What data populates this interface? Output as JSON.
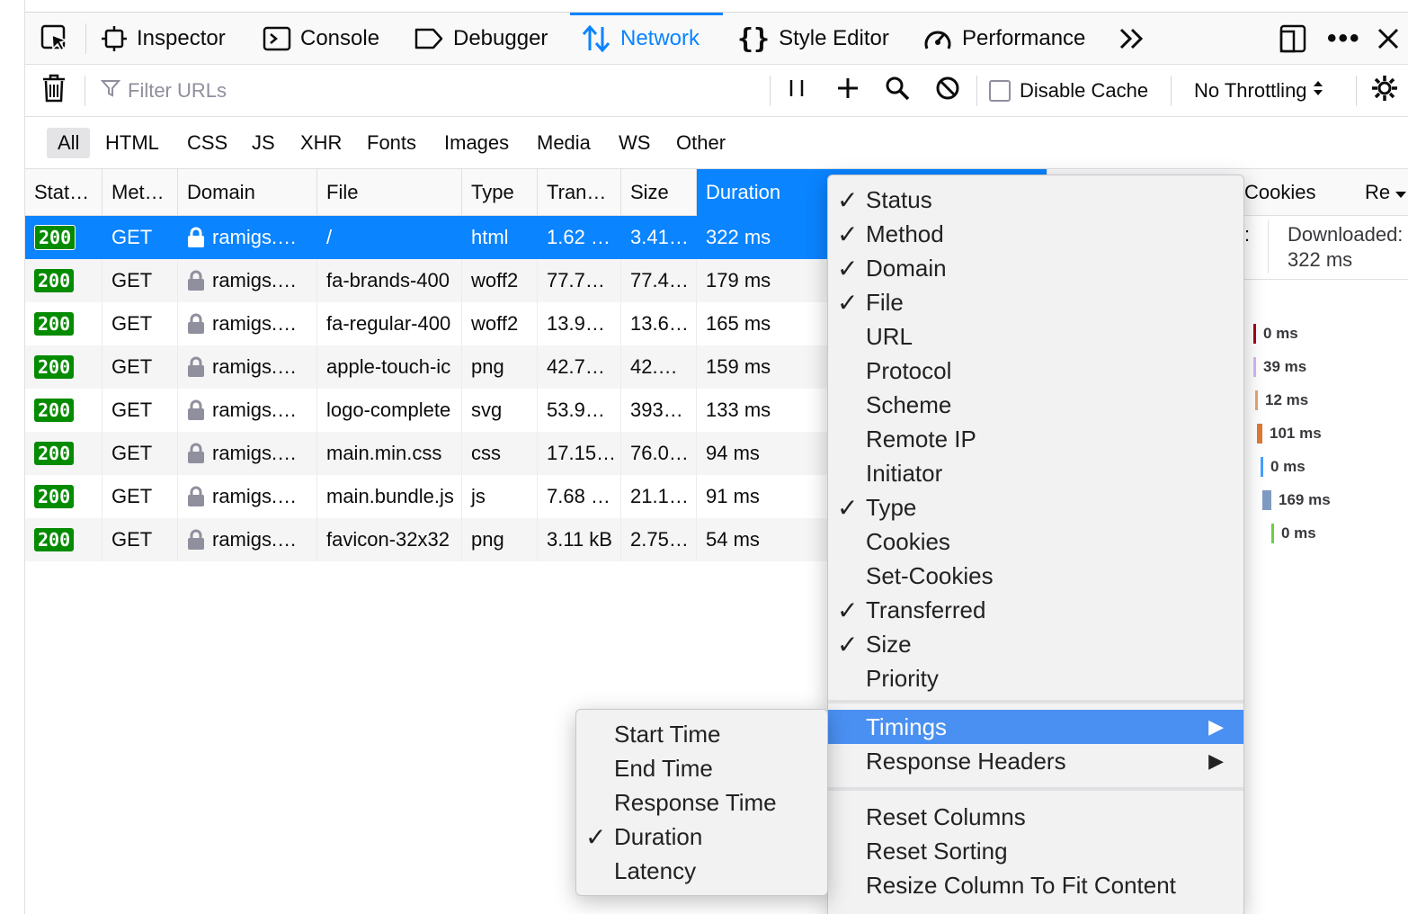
{
  "toolbar": {
    "tabs": [
      {
        "label": "Inspector",
        "icon": "inspector-icon"
      },
      {
        "label": "Console",
        "icon": "console-icon"
      },
      {
        "label": "Debugger",
        "icon": "debugger-icon"
      },
      {
        "label": "Network",
        "icon": "network-icon",
        "active": true
      },
      {
        "label": "Style Editor",
        "icon": "braces-icon"
      },
      {
        "label": "Performance",
        "icon": "gauge-icon"
      }
    ],
    "accent": "#0a84ff"
  },
  "filterbar": {
    "filter_placeholder": "Filter URLs",
    "disable_cache_label": "Disable Cache",
    "throttling_label": "No Throttling"
  },
  "type_filters": [
    "All",
    "HTML",
    "CSS",
    "JS",
    "XHR",
    "Fonts",
    "Images",
    "Media",
    "WS",
    "Other"
  ],
  "table": {
    "headers": [
      "Stat…",
      "Met…",
      "Domain",
      "File",
      "Type",
      "Tran…",
      "Size",
      "Duration",
      "Cookies",
      "Re"
    ],
    "rows": [
      {
        "status": "200",
        "method": "GET",
        "domain": "ramigs.…",
        "file": "/",
        "type": "html",
        "transferred": "1.62 …",
        "size": "3.41…",
        "duration": "322 ms"
      },
      {
        "status": "200",
        "method": "GET",
        "domain": "ramigs.…",
        "file": "fa-brands-400",
        "type": "woff2",
        "transferred": "77.7…",
        "size": "77.4…",
        "duration": "179 ms"
      },
      {
        "status": "200",
        "method": "GET",
        "domain": "ramigs.…",
        "file": "fa-regular-400",
        "type": "woff2",
        "transferred": "13.9…",
        "size": "13.6…",
        "duration": "165 ms"
      },
      {
        "status": "200",
        "method": "GET",
        "domain": "ramigs.…",
        "file": "apple-touch-ic",
        "type": "png",
        "transferred": "42.7…",
        "size": "42.…",
        "duration": "159 ms"
      },
      {
        "status": "200",
        "method": "GET",
        "domain": "ramigs.…",
        "file": "logo-complete",
        "type": "svg",
        "transferred": "53.9…",
        "size": "393…",
        "duration": "133 ms"
      },
      {
        "status": "200",
        "method": "GET",
        "domain": "ramigs.…",
        "file": "main.min.css",
        "type": "css",
        "transferred": "17.15…",
        "size": "76.0…",
        "duration": "94 ms"
      },
      {
        "status": "200",
        "method": "GET",
        "domain": "ramigs.…",
        "file": "main.bundle.js",
        "type": "js",
        "transferred": "7.68 …",
        "size": "21.1…",
        "duration": "91 ms"
      },
      {
        "status": "200",
        "method": "GET",
        "domain": "ramigs.…",
        "file": "favicon-32x32",
        "type": "png",
        "transferred": "3.11 kB",
        "size": "2.75…",
        "duration": "54 ms"
      }
    ]
  },
  "side_panel": {
    "downloaded_label": "Downloaded:",
    "downloaded_value": "322 ms",
    "colon": ":",
    "timings": [
      {
        "value": "0 ms",
        "color": "#a4000f"
      },
      {
        "value": "39 ms",
        "color": "#d7b4f5"
      },
      {
        "value": "12 ms",
        "color": "#e8a36b"
      },
      {
        "value": "101 ms",
        "color": "#e07935"
      },
      {
        "value": "0 ms",
        "color": "#45a1ff"
      },
      {
        "value": "169 ms",
        "color": "#7f9bc2"
      },
      {
        "value": "0 ms",
        "color": "#6ad046"
      }
    ]
  },
  "context_menu": {
    "items": [
      {
        "label": "Status",
        "checked": true
      },
      {
        "label": "Method",
        "checked": true
      },
      {
        "label": "Domain",
        "checked": true
      },
      {
        "label": "File",
        "checked": true
      },
      {
        "label": "URL",
        "checked": false
      },
      {
        "label": "Protocol",
        "checked": false
      },
      {
        "label": "Scheme",
        "checked": false
      },
      {
        "label": "Remote IP",
        "checked": false
      },
      {
        "label": "Initiator",
        "checked": false
      },
      {
        "label": "Type",
        "checked": true
      },
      {
        "label": "Cookies",
        "checked": false
      },
      {
        "label": "Set-Cookies",
        "checked": false
      },
      {
        "label": "Transferred",
        "checked": true
      },
      {
        "label": "Size",
        "checked": true
      },
      {
        "label": "Priority",
        "checked": false
      }
    ],
    "submenus": [
      {
        "label": "Timings",
        "highlighted": true
      },
      {
        "label": "Response Headers",
        "highlighted": false
      }
    ],
    "actions": [
      "Reset Columns",
      "Reset Sorting",
      "Resize Column To Fit Content"
    ],
    "check_mark": "✓",
    "submenu_arrow": "▶"
  },
  "timings_submenu": {
    "items": [
      {
        "label": "Start Time",
        "checked": false
      },
      {
        "label": "End Time",
        "checked": false
      },
      {
        "label": "Response Time",
        "checked": false
      },
      {
        "label": "Duration",
        "checked": true
      },
      {
        "label": "Latency",
        "checked": false
      }
    ]
  }
}
